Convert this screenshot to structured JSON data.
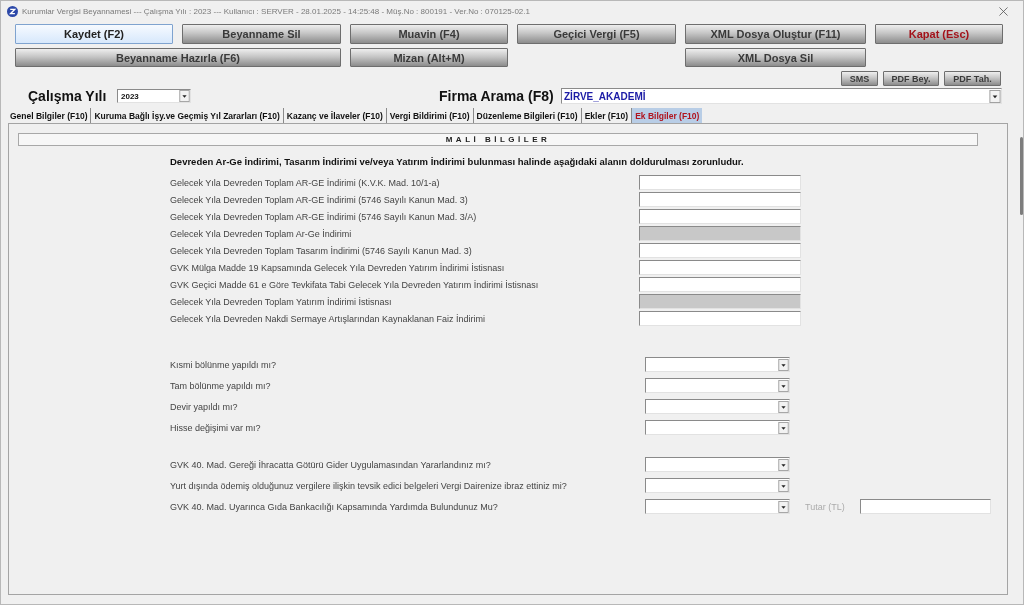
{
  "window": {
    "title": "Kurumlar Vergisi Beyannamesi  ---  Çalışma Yılı : 2023  ---  Kullanıcı : SERVER - 28.01.2025 - 14:25:48 - Müş.No : 800191 - Ver.No : 070125-02.1"
  },
  "toolbar": {
    "buttons": [
      {
        "label": "Kaydet (F2)",
        "kind": "action",
        "focused": true
      },
      {
        "label": "Beyanname Sil",
        "kind": "action",
        "focused": false
      },
      {
        "label": "Muavin (F4)",
        "kind": "action",
        "focused": false
      },
      {
        "label": "Geçici Vergi (F5)",
        "kind": "action",
        "focused": false
      },
      {
        "label": "XML Dosya Oluştur (F11)",
        "kind": "action",
        "focused": false
      },
      {
        "label": "Kapat (Esc)",
        "kind": "exit",
        "focused": false
      },
      {
        "label": "Beyanname Hazırla (F6)",
        "kind": "action",
        "focused": false
      },
      {
        "label": "Mizan (Alt+M)",
        "kind": "action",
        "focused": false
      },
      {
        "label": "XML Dosya Sil",
        "kind": "action",
        "focused": false
      }
    ],
    "small_buttons": [
      "SMS",
      "PDF Bey.",
      "PDF Tah."
    ]
  },
  "filters": {
    "year": {
      "label": "Çalışma Yılı",
      "value": "2023"
    },
    "company": {
      "label": "Firma Arama (F8)",
      "value": "ZİRVE_AKADEMİ"
    }
  },
  "tabs": [
    {
      "label": "Genel Bilgiler (F10)",
      "selected": false
    },
    {
      "label": "Kuruma Bağlı İşy.ve Geçmiş Yıl Zararları (F10)",
      "selected": false
    },
    {
      "label": "Kazanç ve İlaveler (F10)",
      "selected": false
    },
    {
      "label": "Vergi Bildirimi (F10)",
      "selected": false
    },
    {
      "label": "Düzenleme Bilgileri (F10)",
      "selected": false
    },
    {
      "label": "Ekler (F10)",
      "selected": false
    },
    {
      "label": "Ek Bilgiler (F10)",
      "selected": true
    }
  ],
  "panel": {
    "title": "MALİ BİLGİLER",
    "notice": "Devreden Ar-Ge İndirimi, Tasarım İndirimi ve/veya Yatırım İndirimi bulunması halinde aşağıdaki alanın doldurulması zorunludur.",
    "fields": [
      {
        "label": "Gelecek Yıla Devreden Toplam AR-GE İndirimi (K.V.K. Mad. 10/1-a)",
        "disabled": false
      },
      {
        "label": "Gelecek Yıla Devreden Toplam AR-GE İndirimi (5746 Sayılı Kanun Mad. 3)",
        "disabled": false
      },
      {
        "label": "Gelecek Yıla Devreden Toplam AR-GE İndirimi (5746 Sayılı Kanun Mad. 3/A)",
        "disabled": false
      },
      {
        "label": "Gelecek Yıla Devreden Toplam Ar-Ge İndirimi",
        "disabled": true
      },
      {
        "label": "Gelecek Yıla Devreden Toplam Tasarım İndirimi (5746 Sayılı Kanun Mad. 3)",
        "disabled": false
      },
      {
        "label": "GVK Mülga Madde 19 Kapsamında Gelecek Yıla Devreden Yatırım İndirimi İstisnası",
        "disabled": false
      },
      {
        "label": "GVK Geçici Madde 61 e Göre Tevkifata Tabi Gelecek Yıla Devreden Yatırım İndirimi İstisnası",
        "disabled": false
      },
      {
        "label": "Gelecek Yıla Devreden Toplam Yatırım İndirimi İstisnası",
        "disabled": true
      },
      {
        "label": "Gelecek Yıla Devreden Nakdi Sermaye Artışlarından Kaynaklanan Faiz İndirimi",
        "disabled": false
      }
    ],
    "question_groups": [
      {
        "questions": [
          {
            "label": "Kısmi bölünme yapıldı mı?"
          },
          {
            "label": "Tam bölünme yapıldı mı?"
          },
          {
            "label": "Devir yapıldı mı?"
          },
          {
            "label": "Hisse değişimi var mı?"
          }
        ]
      },
      {
        "questions": [
          {
            "label": "GVK 40. Mad. Gereği İhracatta Götürü Gider Uygulamasından Yararlandınız mı?"
          },
          {
            "label": "Yurt dışında ödemiş olduğunuz vergilere ilişkin tevsik edici belgeleri Vergi Dairenize ibraz ettiniz mi?"
          },
          {
            "label": "GVK 40. Mad. Uyarınca Gıda Bankacılığı Kapsamında Yardımda Bulundunuz Mu?",
            "amount": {
              "label": "Tutar (TL)",
              "disabled": true
            }
          }
        ]
      }
    ]
  }
}
